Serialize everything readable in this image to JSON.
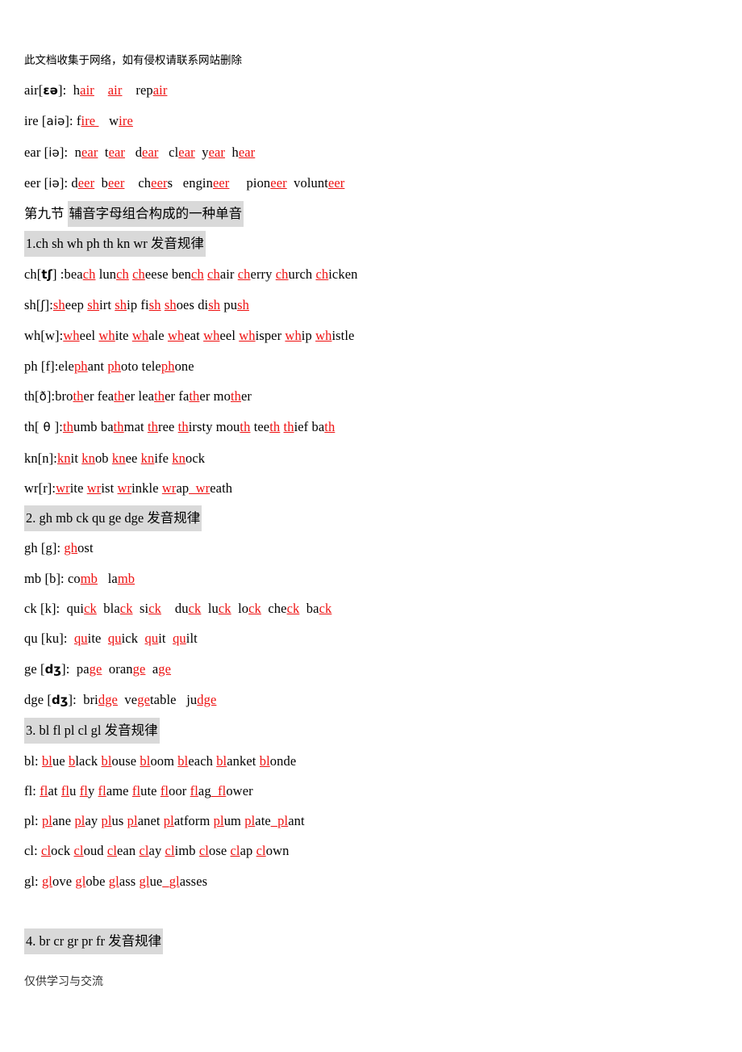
{
  "document": {
    "header_note": "此文档收集于网络，如有侵权请联系网站删除",
    "footer_note": "仅供学习与交流",
    "highlight_color": "#d9d9d9",
    "accent_color": "#ee1111"
  },
  "lines": [
    {
      "id": "air",
      "pattern": "air",
      "ipa": "ɛə",
      "prefix": "air[",
      "ipa_close": "]:",
      "words": [
        "hair",
        "air",
        "repair"
      ],
      "text": "air[ɛə]:   hair    air    repair"
    },
    {
      "id": "ire",
      "pattern": "ire",
      "ipa": "aiə",
      "prefix": "ire [",
      "ipa_close": "]:",
      "words": [
        "fire",
        "wire"
      ],
      "text": "ire [aiə]: fire    wire"
    },
    {
      "id": "ear",
      "pattern": "ear",
      "ipa": "iə",
      "prefix": "ear [",
      "ipa_close": "]:",
      "words": [
        "near",
        "tear",
        "dear",
        "clear",
        "year",
        "hear"
      ],
      "text": "ear [iə]:  near  tear   dear   clear  year  hear"
    },
    {
      "id": "eer",
      "pattern": "eer",
      "ipa": "iə",
      "prefix": "eer [",
      "ipa_close": "]:",
      "words": [
        "deer",
        "beer",
        "cheers",
        "engineer",
        "pioneer",
        "volunteer"
      ],
      "text": "eer [iə]: deer  beer   cheers  engineer   pioneer volunteer"
    }
  ],
  "section_title": {
    "label_plain": "第九节",
    "label_highlighted": "辅音字母组合构成的一种单音",
    "full": "第九节 辅音字母组合构成的一种单音"
  },
  "sections": [
    {
      "number": "1.",
      "heading": "1.ch sh wh ph th kn wr 发音规律",
      "combos": [
        "ch",
        "sh",
        "wh",
        "ph",
        "th",
        "kn",
        "wr"
      ],
      "heading_suffix": "发音规律",
      "rows": [
        {
          "id": "ch",
          "text": "ch[tʃ] :beach lunch cheese bench chair cherry church chicken",
          "letters": "ch",
          "ipa": "tʃ",
          "words": [
            "beach",
            "lunch",
            "cheese",
            "bench",
            "chair",
            "cherry",
            "church",
            "chicken"
          ]
        },
        {
          "id": "sh",
          "text": "sh[ʃ]:sheep shirt ship fish shoes dish push",
          "letters": "sh",
          "ipa": "ʃ",
          "words": [
            "sheep",
            "shirt",
            "ship",
            "fish",
            "shoes",
            "dish",
            "push"
          ]
        },
        {
          "id": "wh",
          "text": "wh[w]:wheel white whale wheat wheel whisper whip whistle",
          "letters": "wh",
          "ipa": "w",
          "words": [
            "wheel",
            "white",
            "whale",
            "wheat",
            "wheel",
            "whisper",
            "whip",
            "whistle"
          ]
        },
        {
          "id": "ph",
          "text": "ph [f]:elephant photo telephone",
          "letters": "ph",
          "ipa": "f",
          "words": [
            "elephant",
            "photo",
            "telephone"
          ]
        },
        {
          "id": "th-voiced",
          "text": "th[ð]:brother feather leather father mother",
          "letters": "th",
          "ipa": "ð",
          "words": [
            "brother",
            "feather",
            "leather",
            "father",
            "mother"
          ]
        },
        {
          "id": "th-voiceless",
          "text": "th[θ]:thumb bathmat three thirsty mouth teeth thief bath",
          "letters": "th",
          "ipa": "θ",
          "words": [
            "thumb",
            "bathmat",
            "three",
            "thirsty",
            "mouth",
            "teeth",
            "thief",
            "bath"
          ]
        },
        {
          "id": "kn",
          "text": "kn[n]:knit knob knee knife knock",
          "letters": "kn",
          "ipa": "n",
          "words": [
            "knit",
            "knob",
            "knee",
            "knife",
            "knock"
          ]
        },
        {
          "id": "wr",
          "text": "wr[r]:write wrist wrinkle wrap wreath",
          "letters": "wr",
          "ipa": "r",
          "words": [
            "write",
            "wrist",
            "wrinkle",
            "wrap",
            "wreath"
          ]
        }
      ]
    },
    {
      "number": "2.",
      "heading": "2. gh mb ck qu ge dge 发音规律",
      "combos": [
        "gh",
        "mb",
        "ck",
        "qu",
        "ge",
        "dge"
      ],
      "heading_suffix": "发音规律",
      "rows": [
        {
          "id": "gh",
          "text": "gh [g]: ghost",
          "letters": "gh",
          "ipa": "g",
          "words": [
            "ghost"
          ]
        },
        {
          "id": "mb",
          "text": "mb [b]: comb  lamb",
          "letters": "mb",
          "ipa": "b",
          "words": [
            "comb",
            "lamb"
          ]
        },
        {
          "id": "ck",
          "text": "ck [k]:  quick  black  sick   duck  luck  lock  check  back",
          "letters": "ck",
          "ipa": "k",
          "words": [
            "quick",
            "black",
            "sick",
            "duck",
            "luck",
            "lock",
            "check",
            "back"
          ]
        },
        {
          "id": "qu",
          "text": "qu [ku]:  quite  quick  quit  quilt",
          "letters": "qu",
          "ipa": "ku",
          "words": [
            "quite",
            "quick",
            "quit",
            "quilt"
          ]
        },
        {
          "id": "ge",
          "text": "ge [dʒ]:  page  orange  age",
          "letters": "ge",
          "ipa": "dʒ",
          "words": [
            "page",
            "orange",
            "age"
          ]
        },
        {
          "id": "dge",
          "text": "dge [dʒ]:  bridge  vegetable   judge",
          "letters": "dge",
          "ipa": "dʒ",
          "words": [
            "bridge",
            "vegetable",
            "judge"
          ]
        }
      ]
    },
    {
      "number": "3.",
      "heading": "3. bl fl pl cl gl 发音规律",
      "combos": [
        "bl",
        "fl",
        "pl",
        "cl",
        "gl"
      ],
      "heading_suffix": "发音规律",
      "rows": [
        {
          "id": "bl",
          "text": "bl: blue black blouse bloom bleach blanket blonde",
          "letters": "bl",
          "words": [
            "blue",
            "black",
            "blouse",
            "bloom",
            "bleach",
            "blanket",
            "blonde"
          ]
        },
        {
          "id": "fl",
          "text": "fl: flat flu fly flame flute floor flag flower",
          "letters": "fl",
          "words": [
            "flat",
            "flu",
            "fly",
            "flame",
            "flute",
            "floor",
            "flag",
            "flower"
          ]
        },
        {
          "id": "pl",
          "text": "pl: plane play plus planet platform plum plate plant",
          "letters": "pl",
          "words": [
            "plane",
            "play",
            "plus",
            "planet",
            "platform",
            "plum",
            "plate",
            "plant"
          ]
        },
        {
          "id": "cl",
          "text": "cl: clock cloud clean clay climb close clap clown",
          "letters": "cl",
          "words": [
            "clock",
            "cloud",
            "clean",
            "clay",
            "climb",
            "close",
            "clap",
            "clown"
          ]
        },
        {
          "id": "gl",
          "text": "gl: glove globe glass glue glasses",
          "letters": "gl",
          "words": [
            "glove",
            "globe",
            "glass",
            "glue",
            "glasses"
          ]
        }
      ]
    },
    {
      "number": "4.",
      "heading": "4. br cr gr pr fr 发音规律",
      "combos": [
        "br",
        "cr",
        "gr",
        "pr",
        "fr"
      ],
      "heading_suffix": "发音规律",
      "rows": []
    }
  ]
}
